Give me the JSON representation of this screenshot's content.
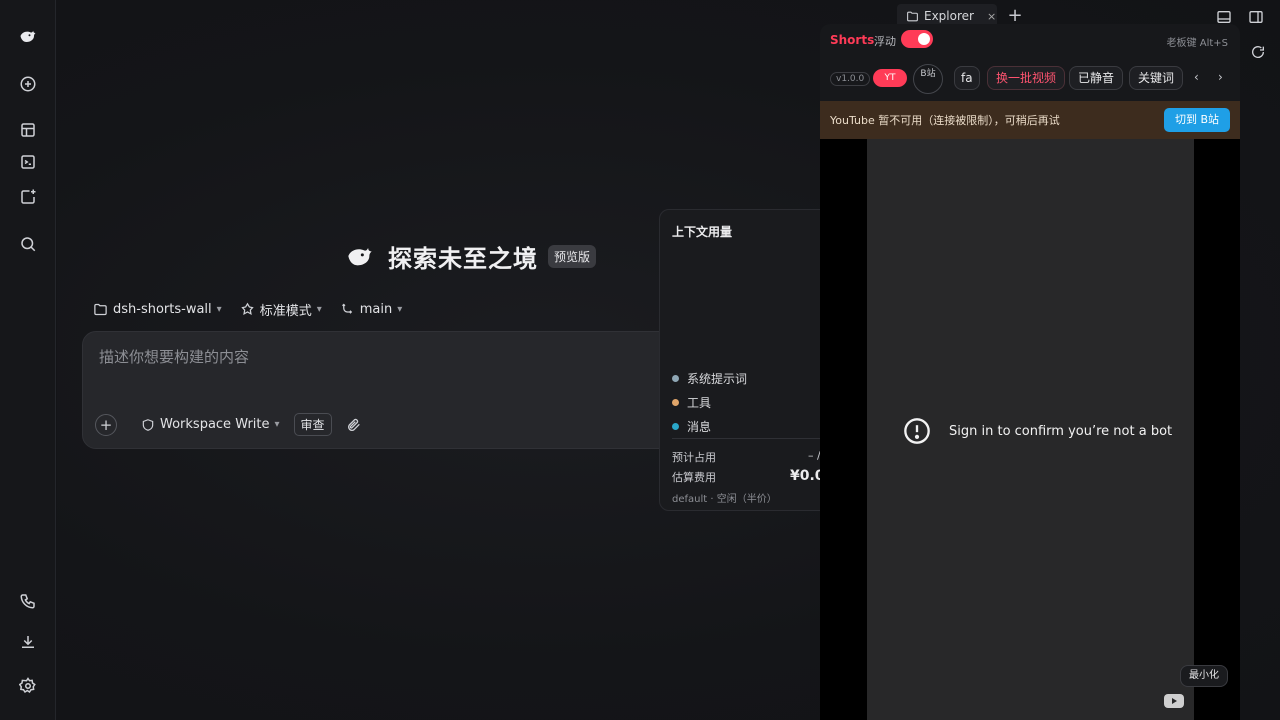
{
  "rail": {
    "items": [
      {
        "icon": "whale-logo-icon"
      },
      {
        "icon": "new-chat-icon"
      },
      {
        "icon": "layout-icon"
      },
      {
        "icon": "terminal-icon"
      },
      {
        "icon": "add-window-icon"
      },
      {
        "icon": "search-icon"
      },
      {
        "icon": "phone-icon"
      },
      {
        "icon": "download-icon"
      },
      {
        "icon": "settings-icon"
      }
    ]
  },
  "top": {
    "tab_label": "Explorer",
    "tab_close": "×",
    "add_tab": "+"
  },
  "hero": {
    "title": "探索未至之境",
    "badge": "预览版"
  },
  "selectors": {
    "project": "dsh-shorts-wall",
    "mode": "标准模式",
    "branch": "main"
  },
  "composer": {
    "placeholder": "描述你想要构建的内容",
    "workspace": "Workspace Write",
    "review": "审查"
  },
  "context": {
    "title": "上下文用量",
    "legend": [
      {
        "label": "系统提示词",
        "color": "#8fa7b5"
      },
      {
        "label": "工具",
        "color": "#e0a56a"
      },
      {
        "label": "消息",
        "color": "#2aa7c9"
      }
    ],
    "estimate_label": "预计占用",
    "estimate_value": "– /",
    "cost_label": "估算费用",
    "cost_value": "¥0.0",
    "footer": "default · 空闲（半价）"
  },
  "shorts": {
    "brand": "Shorts",
    "float_label": "浮动",
    "hotkey": "老板键 Alt+S",
    "version": "v1.0.0",
    "source_yt": "YT",
    "source_b": "B站",
    "chip_partial": "fa",
    "chip_refresh": "换一批视频",
    "chip_muted": "已静音",
    "chip_keywords": "关键词",
    "prev": "‹",
    "next": "›",
    "notice": "YouTube 暂不可用（连接被限制），可稍后再试",
    "switch_button": "切到 B站",
    "player_message": "Sign in to confirm you’re not a bot",
    "minimize": "最小化"
  }
}
